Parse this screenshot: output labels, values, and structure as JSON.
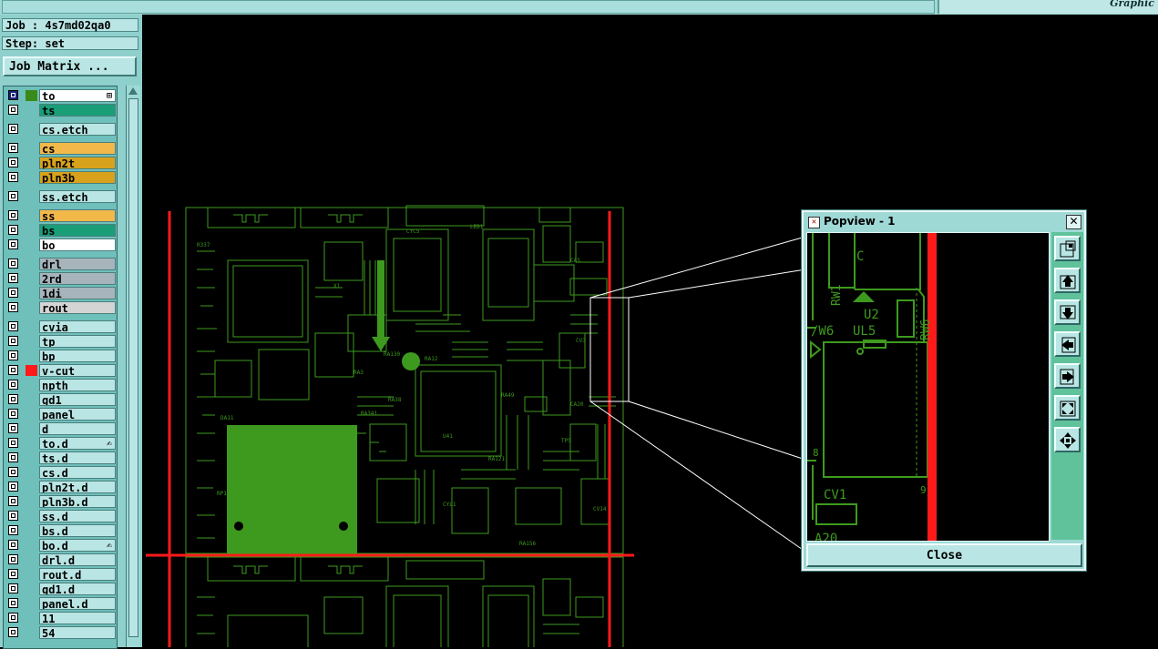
{
  "app": {
    "brand": "Graphic"
  },
  "job": {
    "line": "Job : 4s7md02qa0",
    "step": "Step: set",
    "matrix_button": "Job Matrix ..."
  },
  "layers": [
    {
      "name": "to",
      "color": "#ffffff",
      "swatch": "#3a8a1a",
      "active": true,
      "mark": "⊞"
    },
    {
      "name": "ts",
      "color": "#1a9e78"
    },
    {
      "name": "cs.etch",
      "color": "#b9e6e4",
      "gap": true
    },
    {
      "name": "cs",
      "color": "#f2b84a",
      "gap": true
    },
    {
      "name": "pln2t",
      "color": "#d9a21c"
    },
    {
      "name": "pln3b",
      "color": "#d9a21c"
    },
    {
      "name": "ss.etch",
      "color": "#b9e6e4",
      "gap": true
    },
    {
      "name": "ss",
      "color": "#f2b84a",
      "gap": true
    },
    {
      "name": "bs",
      "color": "#1a9e78"
    },
    {
      "name": "bo",
      "color": "#ffffff"
    },
    {
      "name": "drl",
      "color": "#a7b4bb",
      "gap": true
    },
    {
      "name": "2rd",
      "color": "#a7b4bb"
    },
    {
      "name": "1di",
      "color": "#a7b4bb"
    },
    {
      "name": "rout",
      "color": "#d4d4d4"
    },
    {
      "name": "cvia",
      "color": "#b9e6e4",
      "gap": true
    },
    {
      "name": "tp",
      "color": "#b9e6e4"
    },
    {
      "name": "bp",
      "color": "#b9e6e4"
    },
    {
      "name": "v-cut",
      "color": "#b9e6e4",
      "swatch": "#ff1a1a"
    },
    {
      "name": "npth",
      "color": "#b9e6e4"
    },
    {
      "name": "gd1",
      "color": "#b9e6e4"
    },
    {
      "name": "panel",
      "color": "#b9e6e4"
    },
    {
      "name": "d",
      "color": "#b9e6e4"
    },
    {
      "name": "to.d",
      "color": "#b9e6e4",
      "mark": "✍"
    },
    {
      "name": "ts.d",
      "color": "#b9e6e4"
    },
    {
      "name": "cs.d",
      "color": "#b9e6e4"
    },
    {
      "name": "pln2t.d",
      "color": "#b9e6e4"
    },
    {
      "name": "pln3b.d",
      "color": "#b9e6e4"
    },
    {
      "name": "ss.d",
      "color": "#b9e6e4"
    },
    {
      "name": "bs.d",
      "color": "#b9e6e4"
    },
    {
      "name": "bo.d",
      "color": "#b9e6e4",
      "mark": "✍"
    },
    {
      "name": "drl.d",
      "color": "#b9e6e4"
    },
    {
      "name": "rout.d",
      "color": "#b9e6e4"
    },
    {
      "name": "gd1.d",
      "color": "#b9e6e4"
    },
    {
      "name": "panel.d",
      "color": "#b9e6e4"
    },
    {
      "name": "11",
      "color": "#b9e6e4"
    },
    {
      "name": "54",
      "color": "#b9e6e4"
    }
  ],
  "popview": {
    "title": "Popview - 1",
    "close_label": "Close",
    "labels": {
      "c": "C",
      "rw1": "RW1",
      "rw6": "RW6",
      "u2": "U2",
      "w6": "/W6",
      "ul5": "UL5",
      "cv1": "CV1",
      "a20": "A20",
      "r8": "8",
      "r9": "9"
    },
    "tools": [
      "zoom-fit-icon",
      "move-up-icon",
      "move-down-icon",
      "move-left-icon",
      "move-right-icon",
      "zoom-in-icon",
      "pan-icon"
    ]
  },
  "colors": {
    "trace": "#3e9a1e",
    "vcut": "#ff1a1a",
    "panel_bg": "#9fd9d6"
  }
}
